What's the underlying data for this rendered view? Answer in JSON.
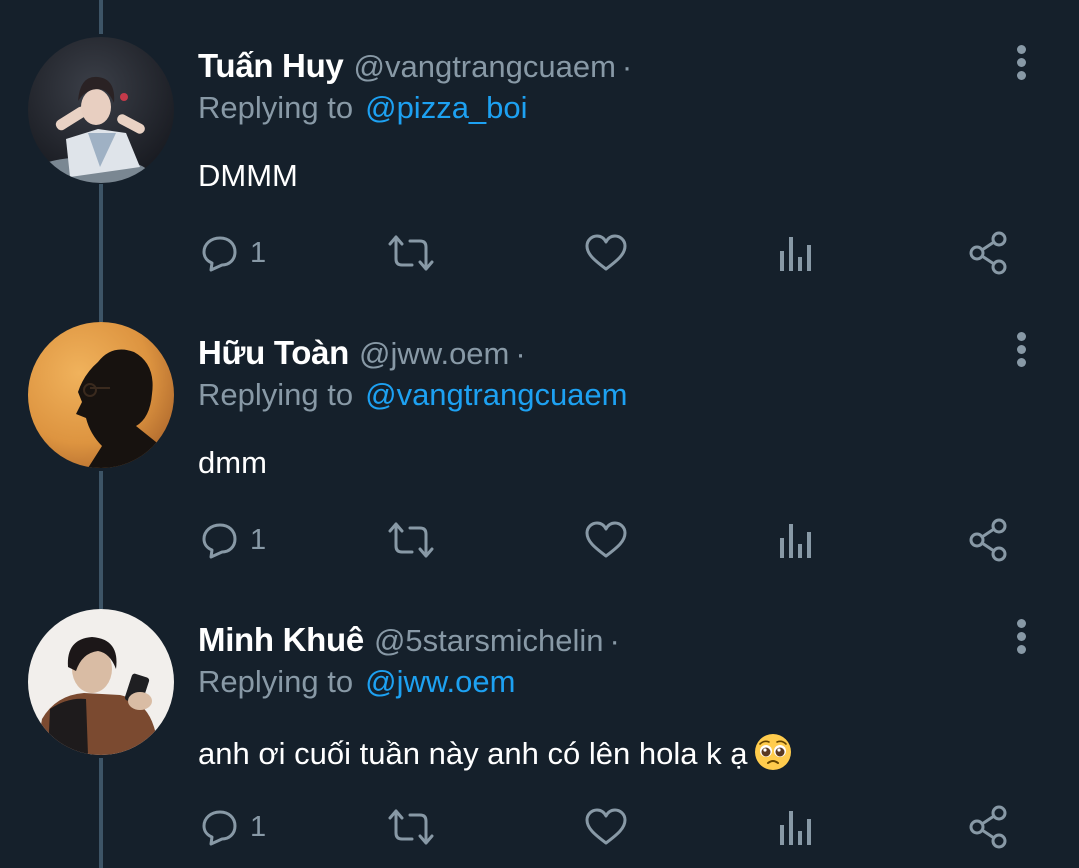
{
  "tweets": [
    {
      "display_name": "Tuấn Huy",
      "handle": "@vangtrangcuaem",
      "separator": "·",
      "reply_prefix": "Replying to",
      "reply_to": "@pizza_boi",
      "text": "DMMM",
      "reply_count": "1",
      "avatar_style": "dance-photo"
    },
    {
      "display_name": "Hữu Toàn",
      "handle": "@jww.oem",
      "separator": "·",
      "reply_prefix": "Replying to",
      "reply_to": "@vangtrangcuaem",
      "text": "dmm",
      "reply_count": "1",
      "avatar_style": "silhouette-orange"
    },
    {
      "display_name": "Minh Khuê",
      "handle": "@5starsmichelin",
      "separator": "·",
      "reply_prefix": "Replying to",
      "reply_to": "@jww.oem",
      "text": "anh ơi cuối tuần này anh có lên hola k ạ",
      "emoji": "pleading-face-emoji",
      "reply_count": "1",
      "avatar_style": "phone-photo"
    }
  ],
  "icons": {
    "reply": "reply-icon",
    "retweet": "retweet-icon",
    "like": "heart-icon",
    "analytics": "analytics-icon",
    "share": "share-icon",
    "more": "more-vertical-icon"
  },
  "colors": {
    "background": "#15202b",
    "text_primary": "#ffffff",
    "text_secondary": "#8899a6",
    "link": "#1da1f2",
    "thread_line": "#3d5466"
  }
}
